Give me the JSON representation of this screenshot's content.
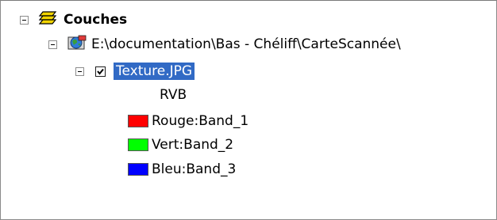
{
  "tree": {
    "root": {
      "label": "Couches",
      "icon": "layers-icon"
    },
    "group": {
      "label": "E:\\documentation\\Bas - Chéliff\\CarteScannée\\",
      "icon": "raster-catalog-icon"
    },
    "layer": {
      "label": "Texture.JPG",
      "checked": true,
      "selected": true
    },
    "legend_title": "RVB",
    "bands": [
      {
        "label": "Rouge:Band_1",
        "color": "#ff0000"
      },
      {
        "label": "Vert:Band_2",
        "color": "#00ff00"
      },
      {
        "label": "Bleu:Band_3",
        "color": "#0000ff"
      }
    ]
  },
  "colors": {
    "selection": "#316ac5"
  }
}
